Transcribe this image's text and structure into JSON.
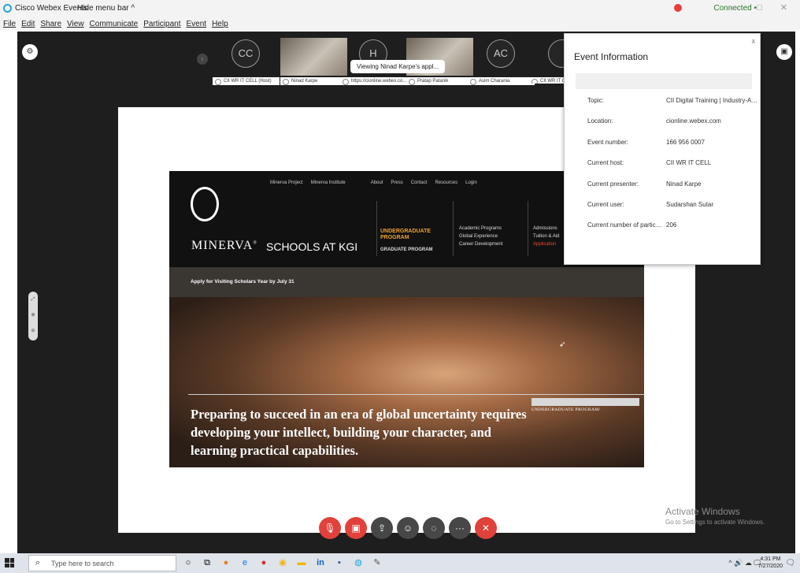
{
  "window": {
    "title": "Cisco Webex Events",
    "hide_menu": "Hide menu bar ^",
    "status": "Connected •",
    "window_controls": "— □ ✕"
  },
  "menu": [
    "File",
    "Edit",
    "Share",
    "View",
    "Communicate",
    "Participant",
    "Event",
    "Help"
  ],
  "participants": [
    {
      "initials": "CC",
      "name": "CII WR IT CELL (Host)",
      "video": false
    },
    {
      "initials": "",
      "name": "Ninad Karpe",
      "video": true
    },
    {
      "initials": "H",
      "name": "https://cionline.webex.co...",
      "video": false
    },
    {
      "initials": "",
      "name": "Pratap Patanik",
      "video": true
    },
    {
      "initials": "AC",
      "name": "Asim Charania",
      "video": false
    },
    {
      "initials": "",
      "name": "CII WR IT C",
      "video": false
    }
  ],
  "viewing_pill": "Viewing Ninad Karpe's appl...",
  "shared_site": {
    "top_nav": [
      "Minerva Project",
      "Minerva Institute",
      "About",
      "Press",
      "Contact",
      "Resources",
      "Login"
    ],
    "brand": "MINERVA",
    "brand_mark": "®",
    "schools": "SCHOOLS AT KGI",
    "undergraduate": "UNDERGRADUATE PROGRAM",
    "graduate": "GRADUATE PROGRAM",
    "programs": [
      "Academic Programs",
      "Global Experience",
      "Career Development"
    ],
    "admissions": [
      "Admissions",
      "Tuition & Aid",
      "Application"
    ],
    "scholars": "Apply for Visiting Scholars Year by July 31",
    "hero_text": "Preparing to succeed in an era of global uncertainty requires developing your intellect, building your character, and learning practical capabilities.",
    "hero_tag": "UNDERGRADUATE PROGRAM/"
  },
  "event_info": {
    "title": "Event Information",
    "close": "x",
    "rows": [
      {
        "label": "Topic:",
        "value": "CII Digital Training | Industry-Aca..."
      },
      {
        "label": "Location:",
        "value": "cionline.webex.com"
      },
      {
        "label": "Event number:",
        "value": "166 956 0007"
      },
      {
        "label": "Current host:",
        "value": "CII WR IT CELL"
      },
      {
        "label": "Current presenter:",
        "value": "Ninad Karpe"
      },
      {
        "label": "Current user:",
        "value": "Sudarshan Sutar"
      },
      {
        "label": "Current number of particip...",
        "value": "206"
      }
    ]
  },
  "controls": [
    {
      "name": "mute",
      "icon": "mic-off-icon",
      "glyph": "🎙",
      "color": "red"
    },
    {
      "name": "video",
      "icon": "video-off-icon",
      "glyph": "▣",
      "color": "red"
    },
    {
      "name": "share",
      "icon": "share-icon",
      "glyph": "⇪",
      "color": "dark"
    },
    {
      "name": "participants",
      "icon": "participants-icon",
      "glyph": "☺",
      "color": "dark"
    },
    {
      "name": "chat",
      "icon": "chat-icon",
      "glyph": "◌",
      "color": "dark"
    },
    {
      "name": "more",
      "icon": "more-icon",
      "glyph": "···",
      "color": "dark"
    },
    {
      "name": "leave",
      "icon": "close-icon",
      "glyph": "✕",
      "color": "red"
    }
  ],
  "watermark": {
    "line1": "Activate Windows",
    "line2": "Go to Settings to activate Windows."
  },
  "taskbar": {
    "search_placeholder": "Type here to search",
    "time": "4:31 PM",
    "date": "7/27/2020"
  },
  "colors": {
    "accent_red": "#e1413b",
    "webex_blue": "#23a6d5",
    "minerva_orange": "#f0a030"
  }
}
